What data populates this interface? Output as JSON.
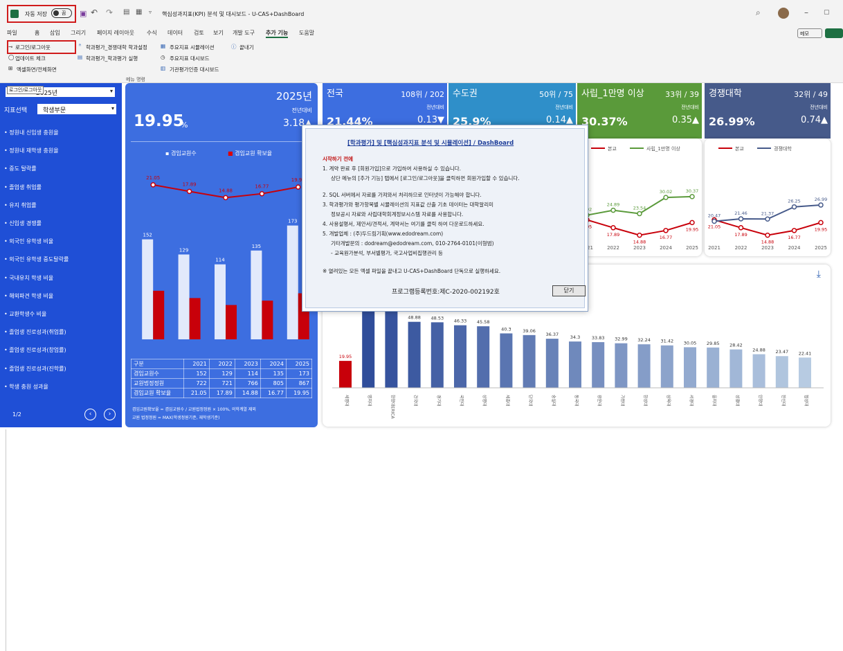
{
  "titlebar": {
    "autosave": "자동 저장",
    "toggle": "끔",
    "title": "핵심성과지표(KPI) 분석 및 대시보드 - U-CAS+DashBoard",
    "memo": "메모"
  },
  "menu": [
    "파일",
    "홈",
    "삽입",
    "그리기",
    "페이지 레이아웃",
    "수식",
    "데이터",
    "검토",
    "보기",
    "개발 도구",
    "추가 기능",
    "도움말"
  ],
  "ribbon": {
    "login": "로그인/로그아웃",
    "update": "업데이트 체크",
    "fullscreen": "엑셀화면/전체화면",
    "rank_setting": "학과평가_경쟁대학 학과설정",
    "rank_run": "학과평가_학과평가 실행",
    "kpi_sim": "주요지표 시뮬레이션",
    "kpi_dash": "주요지표 대시보드",
    "accredit": "기관평가인증 대시보드",
    "exit": "끝내기",
    "group": "메뉴 명령",
    "tooltip": "로그인/로그아웃"
  },
  "sidebar": {
    "year_value": "2025년",
    "year_label": "연도",
    "indicator_label": "지표선택",
    "indicator_value": "학생부문",
    "items": [
      "• 정원내 신입생 충원율",
      "• 정원내 재학생 충원율",
      "• 중도 탈락률",
      "• 졸업생 취업률",
      "• 유지 취업률",
      "• 신입생 경쟁률",
      "• 외국인 유학생 비율",
      "• 외국인 유학생 중도탈락률",
      "• 국내유치 학생 비율",
      "• 해외파견 학생 비율",
      "• 교환학생수 비율",
      "• 졸업생 진로성과(취업률)",
      "• 졸업생 진로성과(창업률)",
      "• 졸업생 진로성과(진학률)",
      "• 학생 충원 성과율"
    ],
    "page": "1/2"
  },
  "main": {
    "year": "2025년",
    "vs": "전년대비",
    "value": "19.95",
    "unit": "%",
    "delta": "3.18▲",
    "legend1": "겸임교원수",
    "legend2": "겸임교원 확보율",
    "years": [
      "2021",
      "2022",
      "2023",
      "2024",
      "2025"
    ],
    "counts": [
      152,
      129,
      114,
      135,
      173
    ],
    "rates": [
      21.05,
      17.89,
      14.88,
      16.77,
      19.95
    ],
    "rate_labels": [
      "21.05",
      "17.89",
      "14.88",
      "16.77",
      "19.95"
    ],
    "count_labels": [
      "152",
      "129",
      "114",
      "135",
      "173"
    ],
    "table": {
      "head": [
        "구분",
        "2021",
        "2022",
        "2023",
        "2024",
        "2025"
      ],
      "rows": [
        [
          "겸임교원수",
          "152",
          "129",
          "114",
          "135",
          "173"
        ],
        [
          "교원법정정원",
          "722",
          "721",
          "766",
          "805",
          "867"
        ],
        [
          "겸임교원 확보율",
          "21.05",
          "17.89",
          "14.88",
          "16.77",
          "19.95"
        ]
      ]
    },
    "note1": "겸임교원확보율 = 겸임교원수 / 교원법정정원 × 100%, 의학계열 제외",
    "note2": "교원 법정정원 = MAX(학생정원기준, 재학생기준)"
  },
  "kpis": [
    {
      "name": "전국",
      "rank": "108위 / 202",
      "vs": "전년대비",
      "value": "21.44%",
      "delta": "0.13▼"
    },
    {
      "name": "수도권",
      "rank": "50위 / 75",
      "vs": "전년대비",
      "value": "25.9%",
      "delta": "0.14▲"
    },
    {
      "name": "사립_1만명 이상",
      "rank": "33위 / 39",
      "vs": "전년대비",
      "value": "30.37%",
      "delta": "0.35▲"
    },
    {
      "name": "경쟁대학",
      "rank": "32위 / 49",
      "vs": "전년대비",
      "value": "26.99%",
      "delta": "0.74▲"
    }
  ],
  "line3": {
    "legend_a": "본교",
    "legend_b": "사립_1만명 이상",
    "years": [
      "2021",
      "2022",
      "2023",
      "2024",
      "2025"
    ],
    "a": [
      21.05,
      17.89,
      14.88,
      16.77,
      19.95
    ],
    "b": [
      22.92,
      24.89,
      23.54,
      30.02,
      30.37
    ],
    "a_labels": [
      "1.05",
      "17.89",
      "14.88",
      "16.77",
      "19.95"
    ],
    "b_labels": [
      "2.92",
      "24.89",
      "23.54",
      "30.02",
      "30.37"
    ]
  },
  "line4": {
    "legend_a": "본교",
    "legend_b": "경쟁대학",
    "years": [
      "2021",
      "2022",
      "2023",
      "2024",
      "2025"
    ],
    "a": [
      21.05,
      17.89,
      14.88,
      16.77,
      19.95
    ],
    "b": [
      20.47,
      21.46,
      21.37,
      26.25,
      26.99
    ],
    "a_labels": [
      "21.05",
      "17.89",
      "14.88",
      "16.77",
      "19.95"
    ],
    "b_labels": [
      "20.47",
      "21.46",
      "21.37",
      "26.25",
      "26.99"
    ]
  },
  "chart_data": {
    "type": "bar",
    "values": [
      19.95,
      60,
      60,
      48.88,
      48.53,
      46.33,
      45.58,
      40.3,
      39.06,
      36.37,
      34.3,
      33.83,
      32.99,
      32.24,
      31.42,
      30.05,
      29.85,
      28.42,
      24.88,
      23.47,
      22.41
    ],
    "labels": [
      "19.95",
      "",
      "",
      "48.88",
      "48.53",
      "46.33",
      "45.58",
      "40.3",
      "39.06",
      "36.37",
      "34.3",
      "33.83",
      "32.99",
      "32.24",
      "31.42",
      "30.05",
      "29.85",
      "28.42",
      "24.88",
      "23.47",
      "22.41"
    ],
    "categories": [
      "세명대",
      "명지대",
      "한양대ERICA",
      "건국대",
      "경기대",
      "국민대",
      "상명대",
      "세종대",
      "단국대",
      "숭실대",
      "동국대",
      "광운대",
      "가천대",
      "한성대",
      "삼육대",
      "서경대",
      "을지대",
      "성결대",
      "안양대",
      "한신대",
      "협성대"
    ]
  },
  "dialog": {
    "title": "[학과평가] 및 [핵심성과지표 분석 및 시뮬레이션] / DashBoard",
    "heading": "시작하기 전에",
    "l1": "1. 계약 완료 후 [회원가입]으로 가입하여 사용하실 수 있습니다.",
    "l1b": "상단 메뉴의 [추가 기능] 탭에서 [로그인/로그아웃]을 클릭하면 회원가입할 수 있습니다.",
    "l2": "2. SQL 서버에서 자료를 가져와서 처리하므로 인터넷이 가능해야 합니다.",
    "l3": "3. 학과평가와 평가항목별 시뮬레이션의 지표값 산출 기초 데이터는 대학알리미",
    "l3b": "정보공시 자료와 사립대학회계정보시스템 자료를 사용합니다.",
    "l4": "4. 사용설명서, 제안서/견적서, 계약서는 여기를 클릭 하여 다운로드하세요.",
    "l5": "5. 개발업체 : (주)두드림기획(www.edodream.com)",
    "l5b": "기타개발문의 : dodream@edodream.com, 010-2764-0101(이형범)",
    "l5c": "- 교육원가분석, 부서별평가, 국고사업비집행관리 등",
    "warn": "※ 열려있는 모든 엑셀 파일을 끝내고 U-CAS+DashBoard 단독으로 실행하세요.",
    "reg": "프로그램등록번호:제C-2020-002192호",
    "close": "닫기"
  }
}
